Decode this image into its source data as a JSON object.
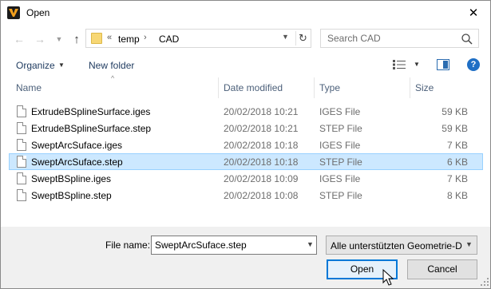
{
  "window": {
    "title": "Open"
  },
  "address": {
    "crumb_prefix": "«",
    "crumbs": [
      "temp",
      "CAD"
    ],
    "separator": "›"
  },
  "search": {
    "placeholder": "Search CAD"
  },
  "toolbar": {
    "organize_label": "Organize",
    "new_folder_label": "New folder",
    "help_label": "?"
  },
  "columns": {
    "name": "Name",
    "date": "Date modified",
    "type": "Type",
    "size": "Size"
  },
  "files": [
    {
      "name": "ExtrudeBSplineSurface.iges",
      "date": "20/02/2018 10:21",
      "type": "IGES File",
      "size": "59 KB",
      "selected": false
    },
    {
      "name": "ExtrudeBSplineSurface.step",
      "date": "20/02/2018 10:21",
      "type": "STEP File",
      "size": "59 KB",
      "selected": false
    },
    {
      "name": "SweptArcSuface.iges",
      "date": "20/02/2018 10:18",
      "type": "IGES File",
      "size": "7 KB",
      "selected": false
    },
    {
      "name": "SweptArcSuface.step",
      "date": "20/02/2018 10:18",
      "type": "STEP File",
      "size": "6 KB",
      "selected": true
    },
    {
      "name": "SweptBSpline.iges",
      "date": "20/02/2018 10:09",
      "type": "IGES File",
      "size": "7 KB",
      "selected": false
    },
    {
      "name": "SweptBSpline.step",
      "date": "20/02/2018 10:08",
      "type": "STEP File",
      "size": "8 KB",
      "selected": false
    }
  ],
  "footer": {
    "file_name_label": "File name:",
    "file_name_value": "SweptArcSuface.step",
    "file_type_value": "Alle unterstützten Geometrie-D",
    "open_label": "Open",
    "cancel_label": "Cancel"
  },
  "colors": {
    "selection_bg": "#cce8ff",
    "selection_border": "#99d1ff",
    "accent": "#0078d7",
    "link_text": "#1e3a5f"
  }
}
